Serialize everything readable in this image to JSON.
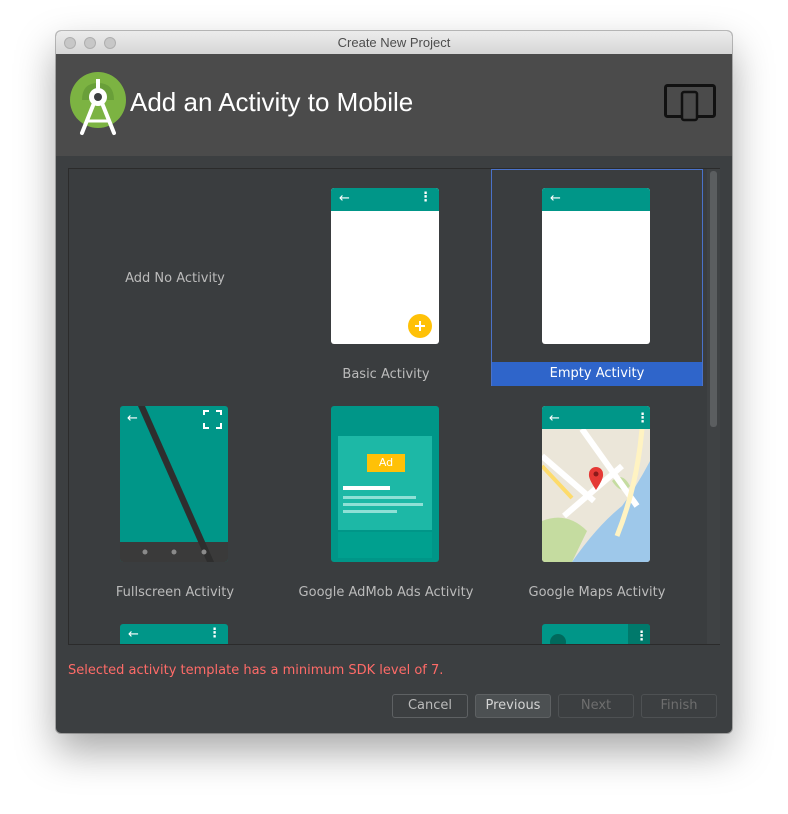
{
  "window": {
    "title": "Create New Project"
  },
  "header": {
    "title": "Add an Activity to Mobile",
    "logo_icon": "android-studio-logo-icon",
    "device_icon": "phone-tablet-icon"
  },
  "templates": [
    {
      "label": "Add No Activity"
    },
    {
      "label": "Basic Activity"
    },
    {
      "label": "Empty Activity",
      "selected": true
    },
    {
      "label": "Fullscreen Activity"
    },
    {
      "label": "Google AdMob Ads Activity",
      "ad_badge": "Ad"
    },
    {
      "label": "Google Maps Activity"
    }
  ],
  "message": "Selected activity template has a minimum SDK level of 7.",
  "buttons": {
    "cancel": "Cancel",
    "previous": "Previous",
    "next": "Next",
    "finish": "Finish"
  },
  "colors": {
    "accent": "#009688",
    "selection": "#2f65ca",
    "error": "#ff6b68",
    "fab": "#ffc107"
  }
}
